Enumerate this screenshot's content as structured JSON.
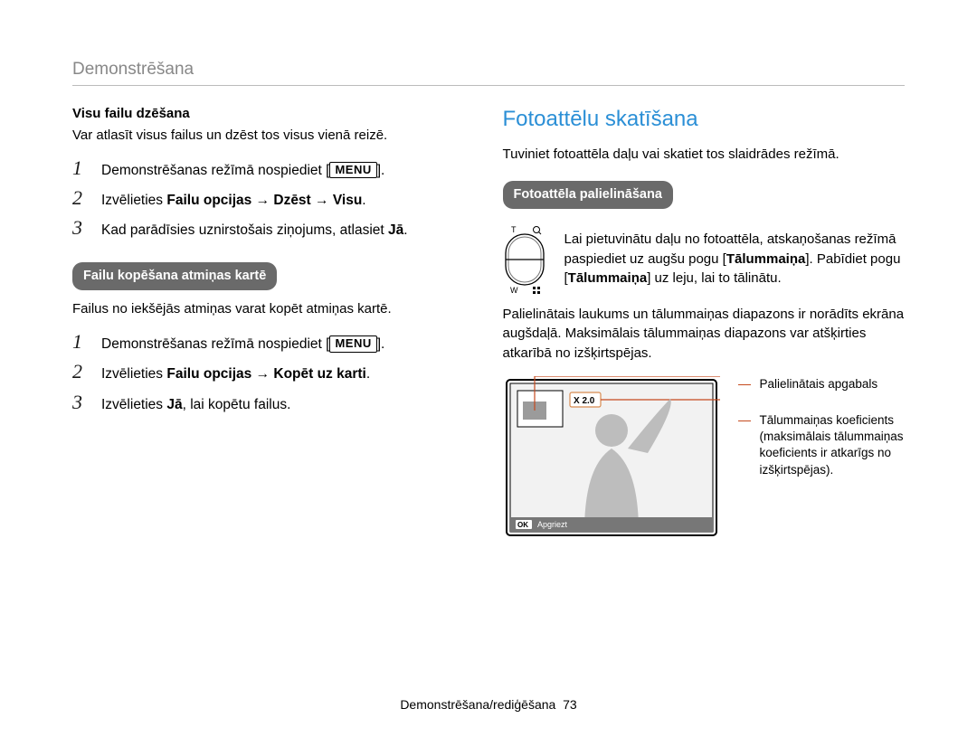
{
  "running_head": "Demonstrēšana",
  "left": {
    "delete_all": {
      "heading": "Visu failu dzēšana",
      "desc": "Var atlasīt visus failus un dzēst tos visus vienā reizē.",
      "step1_pre": "Demonstrēšanas režīmā nospiediet [",
      "step1_post": "].",
      "menu_label": "MENU",
      "step2_pre": "Izvēlieties ",
      "step2_bold": "Failu opcijas → Dzēst → Visu",
      "step2_post": ".",
      "step3_pre": "Kad parādīsies uznirstošais ziņojums, atlasiet ",
      "step3_bold": "Jā",
      "step3_post": "."
    },
    "copy": {
      "heading": "Failu kopēšana atmiņas kartē",
      "desc": "Failus no iekšējās atmiņas varat kopēt atmiņas kartē.",
      "step1_pre": "Demonstrēšanas režīmā nospiediet [",
      "step1_post": "].",
      "menu_label": "MENU",
      "step2_pre": "Izvēlieties ",
      "step2_bold": "Failu opcijas → Kopēt uz karti",
      "step2_post": ".",
      "step3_pre": "Izvēlieties ",
      "step3_bold": "Jā",
      "step3_post": ", lai kopētu failus."
    }
  },
  "right": {
    "title": "Fotoattēlu skatīšana",
    "intro": "Tuviniet fotoattēla daļu vai skatiet tos slaidrādes režīmā.",
    "zoom_heading": "Fotoattēla palielināšana",
    "zoom_labels": {
      "t": "T",
      "w": "W"
    },
    "zoom_desc_a": "Lai pietuvinātu daļu no fotoattēla, atskaņošanas režīmā paspiediet uz augšu pogu [",
    "zoom_desc_b": "Tālummaiņa",
    "zoom_desc_c": "]. Pabīdiet pogu [",
    "zoom_desc_d": "Tālummaiņa",
    "zoom_desc_e": "] uz leju, lai to tālinātu.",
    "zoom_paragraph": "Palielinātais laukums un tālummaiņas diapazons ir norādīts ekrāna augšdaļā. Maksimālais tālummaiņas diapazons var atšķirties atkarībā no izšķirtspējas.",
    "lcd": {
      "zoom_tag": "X 2.0",
      "ok": "OK",
      "crop": "Apgriezt"
    },
    "callouts": {
      "area": "Palielinātais apgabals",
      "coeff": "Tālummaiņas koeficients (maksimālais tālummaiņas koeficients ir atkarīgs no izšķirtspējas)."
    }
  },
  "footer": {
    "section": "Demonstrēšana/rediģēšana",
    "page": "73"
  }
}
